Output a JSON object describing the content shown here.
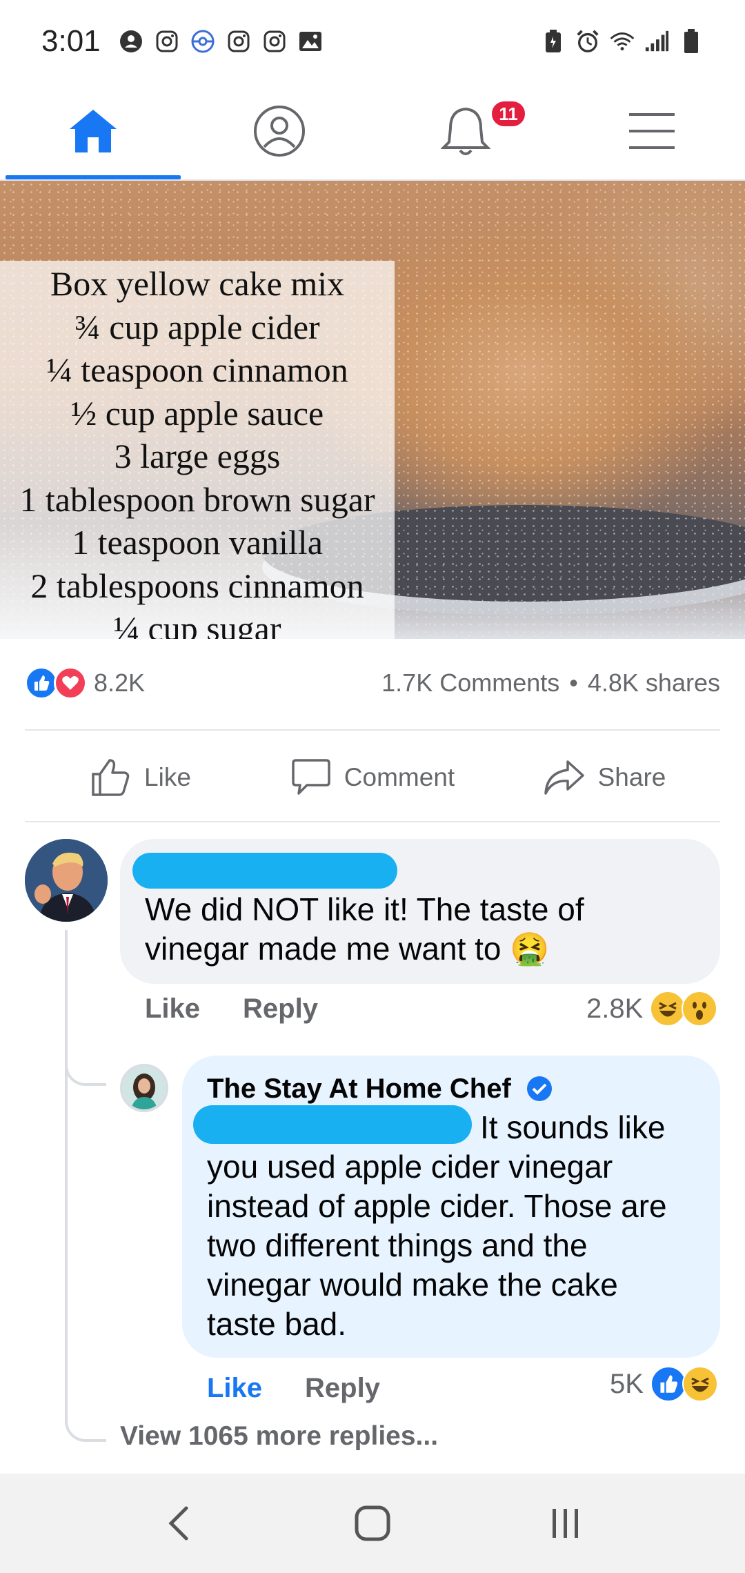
{
  "status_bar": {
    "time": "3:01",
    "left_icons": [
      "account-icon",
      "instagram-icon",
      "pokeball-icon",
      "instagram-icon",
      "instagram-icon",
      "gallery-icon"
    ],
    "right_icons": [
      "battery-saver-icon",
      "alarm-icon",
      "wifi-icon",
      "signal-icon",
      "battery-icon"
    ]
  },
  "nav": {
    "tabs": [
      {
        "name": "home",
        "icon": "home-icon",
        "active": true
      },
      {
        "name": "profile",
        "icon": "profile-icon",
        "active": false
      },
      {
        "name": "notifications",
        "icon": "bell-icon",
        "active": false,
        "badge": "11"
      },
      {
        "name": "menu",
        "icon": "hamburger-icon",
        "active": false
      }
    ],
    "accent_color": "#1877f2"
  },
  "post": {
    "ingredients": [
      "Box yellow cake mix",
      "¾ cup apple cider",
      "¼ teaspoon cinnamon",
      "½ cup apple sauce",
      "3 large eggs",
      "1 tablespoon brown sugar",
      "1 teaspoon vanilla",
      "2 tablespoons cinnamon",
      "¼ cup sugar"
    ],
    "reactions_count": "8.2K",
    "comments_count": "1.7K Comments",
    "separator": "•",
    "shares_count": "4.8K shares",
    "actions": {
      "like": "Like",
      "comment": "Comment",
      "share": "Share"
    }
  },
  "comments": [
    {
      "text": "We did NOT like it!  The taste of vinegar made me want to 🤮",
      "like_label": "Like",
      "reply_label": "Reply",
      "reaction_count": "2.8K",
      "reactions": [
        "haha",
        "wow"
      ],
      "replies": [
        {
          "author": "The Stay At Home Chef",
          "verified": true,
          "text": "It sounds like you used apple cider vinegar instead of apple cider. Those are two different things and the vinegar would make the cake taste bad.",
          "like_label": "Like",
          "reply_label": "Reply",
          "reaction_count": "5K",
          "reactions": [
            "like",
            "haha"
          ]
        }
      ],
      "view_more": "View 1065 more replies..."
    }
  ]
}
